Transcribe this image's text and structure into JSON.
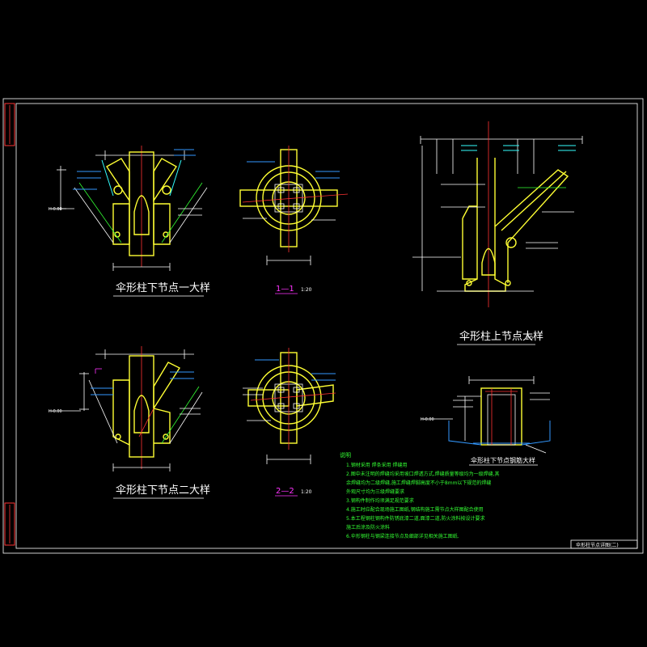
{
  "drawing": {
    "view_titles": {
      "lower_node_1": "伞形柱下节点一大样",
      "lower_node_2": "伞形柱下节点二大样",
      "upper_node": "伞形柱上节点大样",
      "base_section": "伞形柱下节点钢筋大样"
    },
    "sections": [
      {
        "label": "1—1",
        "scale": "1:20"
      },
      {
        "label": "2—2",
        "scale": "1:20"
      }
    ],
    "upper_node_scale": "20",
    "elevation_mark": "H-0.00",
    "notes": {
      "heading": "说明",
      "items": [
        "1.钢材采用    焊条采用    焊缝用",
        "2.图中未注明的焊缝均采用坡口焊透方式,焊缝质量等级均为一级焊缝,其",
        "   余焊缝均为二级焊缝,施工焊缝焊脚高度不小于8mm以下规范的焊缝",
        "   外观尺寸均为三级焊缝要求",
        "3.钢构件制作均须满足规范要求",
        "4.施工时应配合现场施工图纸,钢结构施工需节点大样图配合使用",
        "5.本工程钢柱钢构件防锈底漆二道,面漆二道,防火涂料按设计要求",
        "   施工后涂及防火涂料",
        "6.伞形钢柱与钢梁连接节点及细部详见相关施工图纸."
      ]
    },
    "title_block_text": "伞形柱节点详图(二)"
  }
}
